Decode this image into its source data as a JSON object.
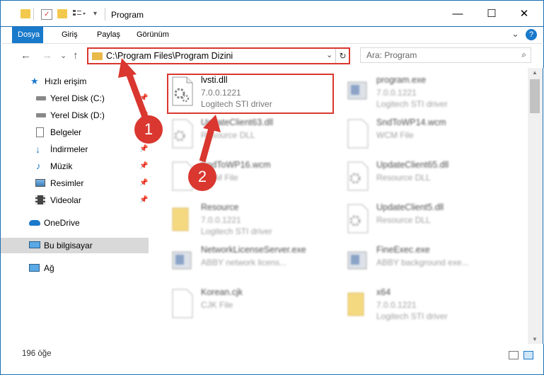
{
  "window": {
    "title": "Program",
    "minimize": "—",
    "maximize": "☐",
    "close": "✕"
  },
  "ribbon": {
    "tabs": [
      "Dosya",
      "Giriş",
      "Paylaş",
      "Görünüm"
    ],
    "collapse_icon": "⌄",
    "help_icon": "?"
  },
  "nav": {
    "back": "←",
    "forward": "→",
    "history": "⌄",
    "up": "↑"
  },
  "address": {
    "path": "C:\\Program Files\\Program Dizini",
    "dropdown": "⌄",
    "refresh": "↻"
  },
  "search": {
    "placeholder": "Ara: Program",
    "icon": "⌕"
  },
  "sidebar": {
    "items": [
      {
        "label": "Hızlı erişim",
        "icon": "star-icon",
        "pinned": false
      },
      {
        "label": "Yerel Disk (C:)",
        "icon": "drive-icon",
        "pinned": true
      },
      {
        "label": "Yerel Disk (D:)",
        "icon": "drive-icon",
        "pinned": true
      },
      {
        "label": "Belgeler",
        "icon": "documents-icon",
        "pinned": true
      },
      {
        "label": "İndirmeler",
        "icon": "downloads-icon",
        "pinned": true
      },
      {
        "label": "Müzik",
        "icon": "music-icon",
        "pinned": true
      },
      {
        "label": "Resimler",
        "icon": "pictures-icon",
        "pinned": true
      },
      {
        "label": "Videolar",
        "icon": "videos-icon",
        "pinned": true
      },
      {
        "label": "OneDrive",
        "icon": "cloud-icon",
        "pinned": false
      },
      {
        "label": "Bu bilgisayar",
        "icon": "computer-icon",
        "pinned": false
      },
      {
        "label": "Ağ",
        "icon": "network-icon",
        "pinned": false
      }
    ],
    "pin_glyph": "📌"
  },
  "files": [
    {
      "name": "lvsti.dll",
      "line2": "7.0.0.1221",
      "line3": "Logitech STI driver",
      "icon": "dll-gear-icon"
    },
    {
      "name": "program.exe",
      "line2": "7.0.0.1221",
      "line3": "Logitech STI driver",
      "icon": "exe-icon"
    },
    {
      "name": "UpdateClient63.dll",
      "line2": "Resource DLL",
      "line3": "",
      "icon": "dll-gear-icon"
    },
    {
      "name": "SndToWP14.wcm",
      "line2": "WCM File",
      "line3": "",
      "icon": "file-icon"
    },
    {
      "name": "SndToWP16.wcm",
      "line2": "WCM File",
      "line3": "",
      "icon": "file-icon"
    },
    {
      "name": "UpdateClient65.dll",
      "line2": "Resource DLL",
      "line3": "",
      "icon": "dll-gear-icon"
    },
    {
      "name": "Resource",
      "line2": "7.0.0.1221",
      "line3": "Logitech STI driver",
      "icon": "folder-icon"
    },
    {
      "name": "UpdateClient5.dll",
      "line2": "Resource DLL",
      "line3": "",
      "icon": "dll-gear-icon"
    },
    {
      "name": "NetworkLicenseServer.exe",
      "line2": "ABBY network licens...",
      "line3": "",
      "icon": "exe-icon"
    },
    {
      "name": "FineExec.exe",
      "line2": "ABBY background exe...",
      "line3": "",
      "icon": "exe-icon"
    },
    {
      "name": "Korean.cjk",
      "line2": "CJK File",
      "line3": "",
      "icon": "file-icon"
    },
    {
      "name": "x64",
      "line2": "7.0.0.1221",
      "line3": "Logitech STI driver",
      "icon": "folder-icon"
    }
  ],
  "status": {
    "count": "196 öğe"
  },
  "callouts": [
    "1",
    "2"
  ],
  "colors": {
    "accent": "#1979ca",
    "highlight": "#d9372f",
    "selected": "#d9d9d9"
  }
}
